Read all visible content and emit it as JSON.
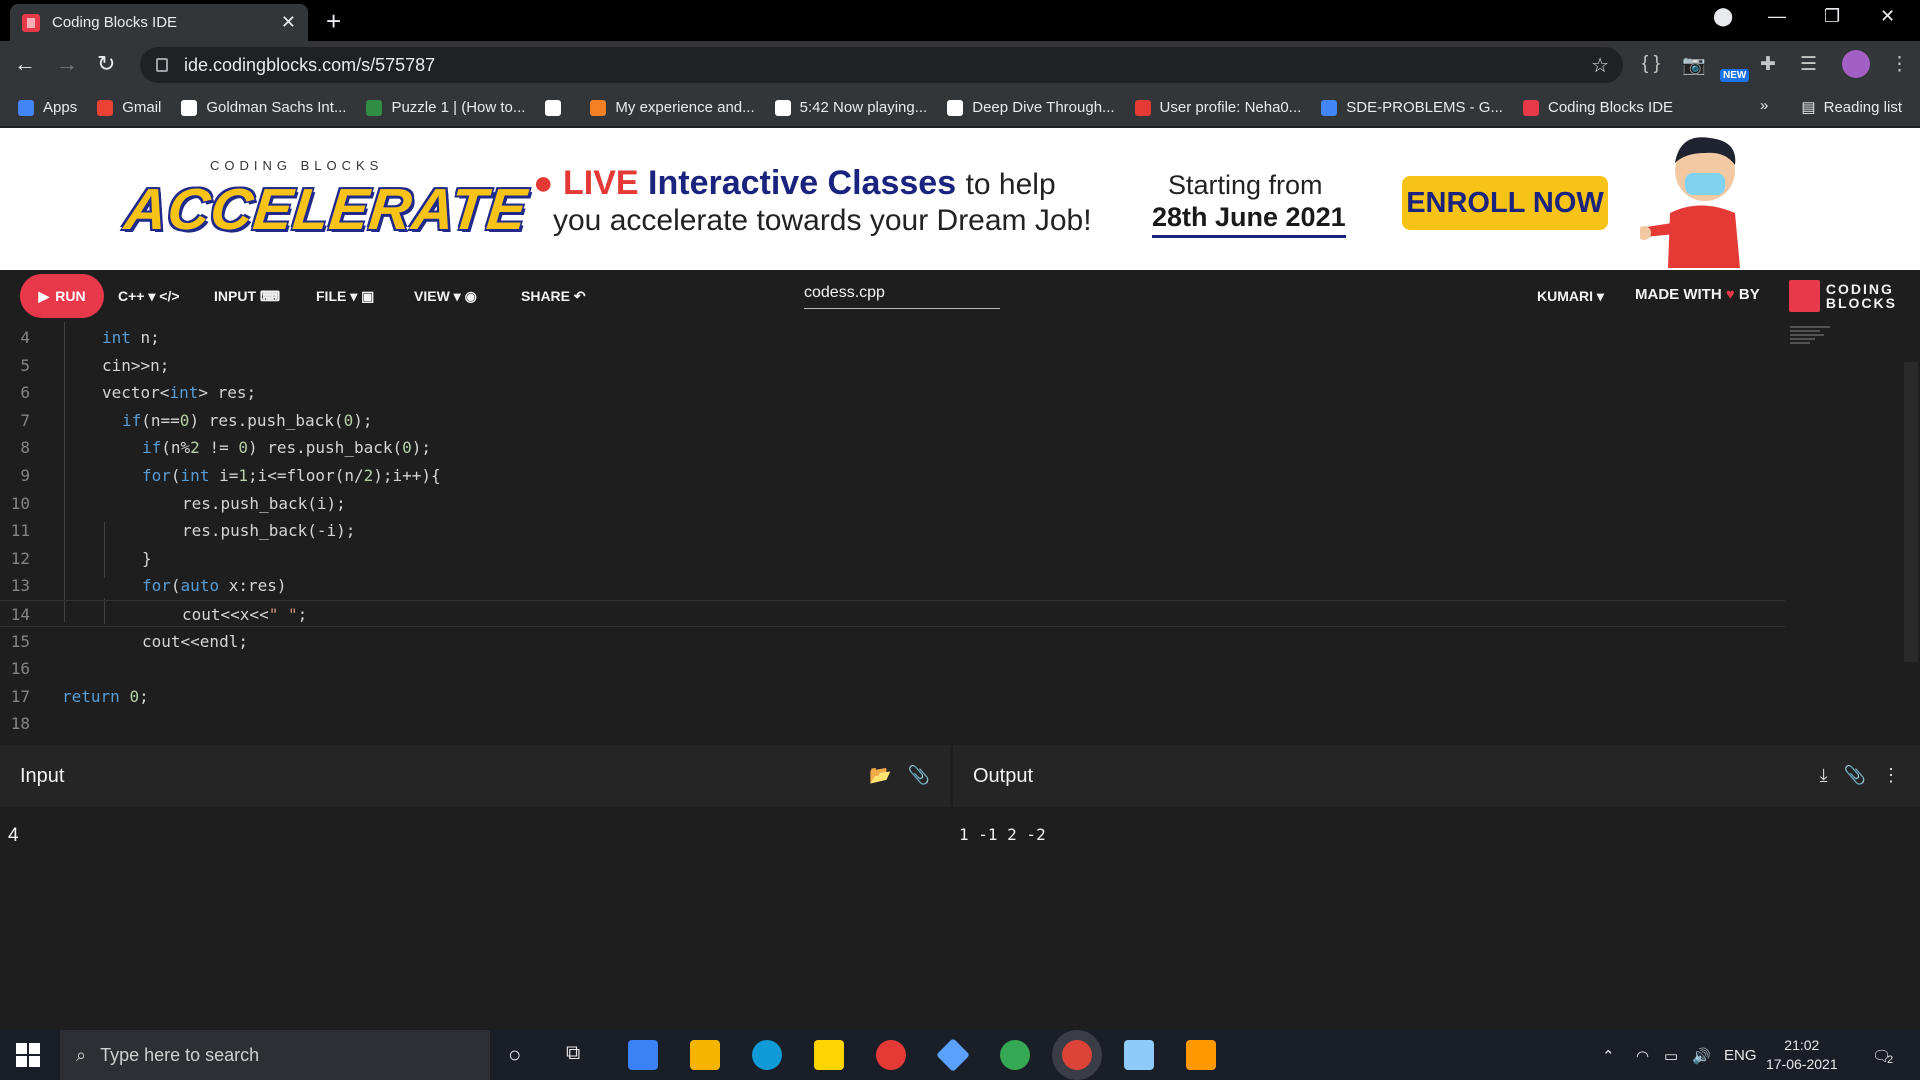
{
  "browser": {
    "tab_title": "Coding Blocks IDE",
    "url": "ide.codingblocks.com/s/575787",
    "bookmarks": [
      {
        "label": "Apps",
        "color": "#4285f4"
      },
      {
        "label": "Gmail",
        "color": "#ea4335"
      },
      {
        "label": "Goldman Sachs Int...",
        "color": "#ffffff"
      },
      {
        "label": "Puzzle 1 | (How to...",
        "color": "#2f8d46"
      },
      {
        "label": "",
        "color": "#ffffff"
      },
      {
        "label": "My experience and...",
        "color": "#f48024"
      },
      {
        "label": "5:42 Now playing...",
        "color": "#ffffff"
      },
      {
        "label": "Deep Dive Through...",
        "color": "#ffffff"
      },
      {
        "label": "User profile: Neha0...",
        "color": "#e53935"
      },
      {
        "label": "SDE-PROBLEMS - G...",
        "color": "#4285f4"
      },
      {
        "label": "Coding Blocks IDE",
        "color": "#e8394a"
      }
    ],
    "more_bookmarks": "»",
    "reading_list": "Reading list",
    "ext_new_badge": "NEW"
  },
  "banner": {
    "coding_blocks": "CODING BLOCKS",
    "accelerate": "ACCELERATE",
    "live": "LIVE",
    "interactive": "Interactive Classes",
    "to_help": "to help",
    "line2": "you accelerate towards your Dream Job!",
    "starting_from": "Starting from",
    "start_date": "28th June 2021",
    "enroll": "ENROLL NOW"
  },
  "ide": {
    "run": "RUN",
    "language": "C++",
    "input": "INPUT",
    "file": "FILE",
    "view": "VIEW",
    "share": "SHARE",
    "filename": "codess.cpp",
    "theme": "KUMARI",
    "made_with": "MADE WITH",
    "by": "BY",
    "logo_line1": "CODING",
    "logo_line2": "BLOCKS"
  },
  "code_lines": [
    {
      "n": "4",
      "indent": 2
    },
    {
      "n": "5",
      "indent": 2
    },
    {
      "n": "6",
      "indent": 2
    },
    {
      "n": "7",
      "indent": 3
    },
    {
      "n": "8",
      "indent": 4
    },
    {
      "n": "9",
      "indent": 4
    },
    {
      "n": "10",
      "indent": 6
    },
    {
      "n": "11",
      "indent": 6
    },
    {
      "n": "12",
      "indent": 4
    },
    {
      "n": "13",
      "indent": 4
    },
    {
      "n": "14",
      "indent": 6
    },
    {
      "n": "15",
      "indent": 4
    },
    {
      "n": "16",
      "indent": 0
    },
    {
      "n": "17",
      "indent": 0
    },
    {
      "n": "18",
      "indent": 0
    }
  ],
  "code_text": {
    "l4": [
      "int",
      " n;"
    ],
    "l5": [
      "cin>>n;"
    ],
    "l6": [
      "vector<",
      "int",
      "> res;"
    ],
    "l7": [
      "if",
      "(n==",
      "0",
      ") res.push_back(",
      "0",
      ");"
    ],
    "l8": [
      "if",
      "(n%",
      "2",
      " != ",
      "0",
      ") res.push_back(",
      "0",
      ");"
    ],
    "l9": [
      "for",
      "(",
      "int",
      " i=",
      "1",
      ";i<=floor(n/",
      "2",
      ");i++){"
    ],
    "l10": [
      "res.push_back(i);"
    ],
    "l11": [
      "res.push_back(-i);"
    ],
    "l12": [
      "}"
    ],
    "l13": [
      "for",
      "(",
      "auto",
      " x:res)"
    ],
    "l14": [
      "cout<<x<<",
      "\" \"",
      ";"
    ],
    "l15": [
      "cout<<endl;"
    ],
    "l16": [
      ""
    ],
    "l17": [
      "return",
      " ",
      "0",
      ";"
    ],
    "l18": [
      ""
    ]
  },
  "io": {
    "input_title": "Input",
    "output_title": "Output",
    "input_value": "4",
    "output_value": "1 -1 2 -2"
  },
  "taskbar": {
    "search_placeholder": "Type here to search",
    "lang": "ENG",
    "time": "21:02",
    "date": "17-06-2021",
    "notifications": "2"
  }
}
